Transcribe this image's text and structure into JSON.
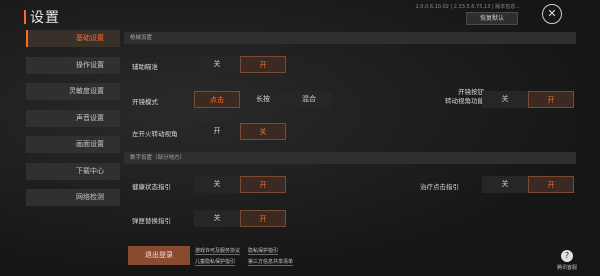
{
  "header": {
    "title": "设置"
  },
  "status": {
    "line": "1.0.0.6.10.02 | 2.33.5.6.75.13 | 版本信息..."
  },
  "top_actions": {
    "restore_default": "恢复默认",
    "close": "✕"
  },
  "sidebar": {
    "items": [
      {
        "label": "基础设置",
        "active": true
      },
      {
        "label": "操作设置",
        "active": false
      },
      {
        "label": "灵敏度设置",
        "active": false
      },
      {
        "label": "声音设置",
        "active": false
      },
      {
        "label": "画面设置",
        "active": false
      },
      {
        "label": "下载中心",
        "active": false
      },
      {
        "label": "网络检测",
        "active": false
      }
    ]
  },
  "sections": {
    "fire": "枪械设置",
    "sub": "数字设置（部分地方）"
  },
  "settings": {
    "assist_aim": {
      "label": "辅助瞄准",
      "off": "关",
      "on": "开",
      "selected": "on"
    },
    "fire_mode": {
      "label": "开镜模式",
      "tap": "点击",
      "hold": "长按",
      "mixed": "混合",
      "selected": "tap"
    },
    "left_fire_view": {
      "label": "左开火转动视角",
      "on": "开",
      "off": "关",
      "selected": "off"
    },
    "scope_turn": {
      "label_line1": "开镜按钮",
      "label_line2": "转动视角功能",
      "off": "关",
      "on": "开",
      "selected": "on"
    },
    "health_guide": {
      "label": "健康状态指引",
      "off": "关",
      "on": "开",
      "selected": "on"
    },
    "heal_guide": {
      "label": "治疗点击指引",
      "off": "关",
      "on": "开",
      "selected": "on"
    },
    "ammo_guide": {
      "label": "弹匣替换指引",
      "off": "关",
      "on": "开",
      "selected": "on"
    }
  },
  "footer": {
    "logout": "退出登录",
    "links": [
      "游戏许可及服务协议",
      "隐私保护指引",
      "儿童隐私保护指引",
      "第三方信息共享清单"
    ],
    "help_label": "腾讯客服"
  },
  "colors": {
    "accent": "#ff6a2b",
    "logout_bg": "#8a4a30"
  }
}
